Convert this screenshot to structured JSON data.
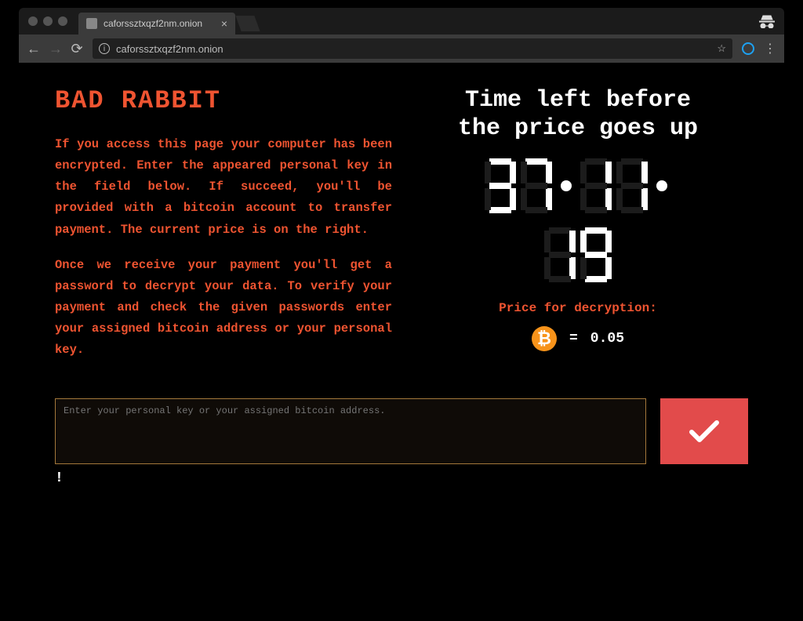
{
  "browser": {
    "tab_title": "caforssztxqzf2nm.onion",
    "url": "caforssztxqzf2nm.onion"
  },
  "page": {
    "title": "BAD RABBIT",
    "para1": "If you access this page your computer has been encrypted. Enter the appeared personal key in the field below. If succeed, you'll be provided with a bitcoin account to transfer payment. The current price is on the right.",
    "para2": "Once we receive your payment you'll get a password to decrypt your data. To verify your payment and check the given passwords enter your assigned bitcoin address or your personal key.",
    "timer_heading_l1": "Time left before",
    "timer_heading_l2": "the price goes up",
    "timer": {
      "hours": "37",
      "minutes": "11",
      "seconds": "19"
    },
    "price_label": "Price for decryption:",
    "price_eq": "=",
    "price_value": "0.05",
    "input_placeholder": "Enter your personal key or your assigned bitcoin address.",
    "footer_mark": "!"
  }
}
